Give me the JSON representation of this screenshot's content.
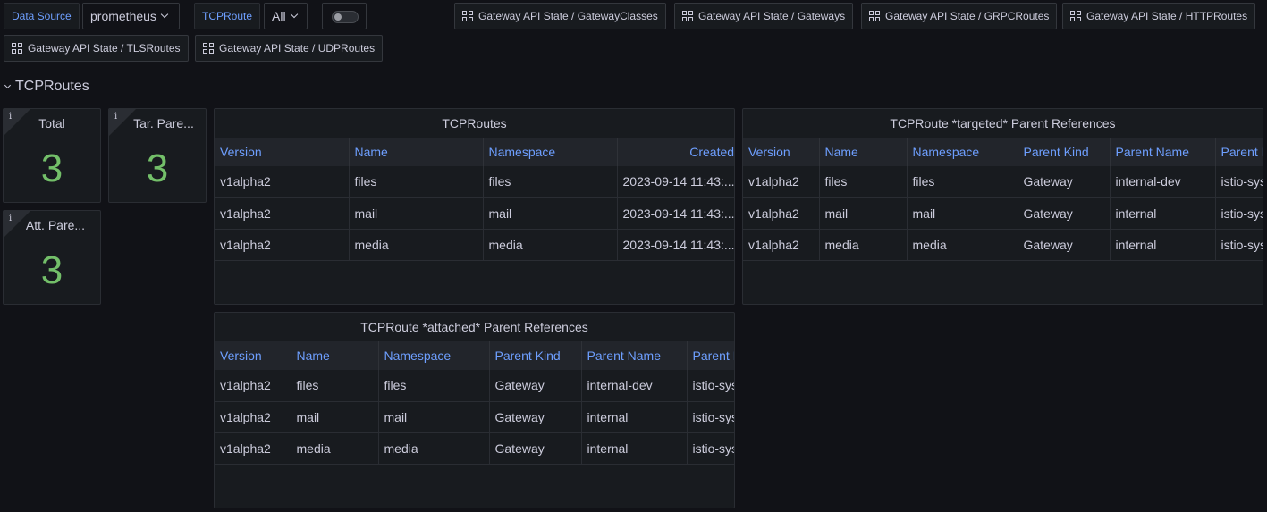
{
  "variables": {
    "datasource_label": "Data Source",
    "datasource_value": "prometheus",
    "tcproute_label": "TCPRoute",
    "tcproute_value": "All"
  },
  "links": [
    "Gateway API State / GatewayClasses",
    "Gateway API State / Gateways",
    "Gateway API State / GRPCRoutes",
    "Gateway API State / HTTPRoutes",
    "Gateway API State / TLSRoutes",
    "Gateway API State / UDPRoutes"
  ],
  "row_title": "TCPRoutes",
  "stats": [
    {
      "title": "Total",
      "value": "3"
    },
    {
      "title": "Tar. Pare...",
      "value": "3"
    },
    {
      "title": "Att. Pare...",
      "value": "3"
    }
  ],
  "tcproutes_table": {
    "title": "TCPRoutes",
    "headers": [
      "Version",
      "Name",
      "Namespace",
      "Created A"
    ],
    "rows": [
      [
        "v1alpha2",
        "files",
        "files",
        "2023-09-14 11:43:..."
      ],
      [
        "v1alpha2",
        "mail",
        "mail",
        "2023-09-14 11:43:..."
      ],
      [
        "v1alpha2",
        "media",
        "media",
        "2023-09-14 11:43:..."
      ]
    ]
  },
  "targeted_table": {
    "title": "TCPRoute *targeted* Parent References",
    "headers": [
      "Version",
      "Name",
      "Namespace",
      "Parent Kind",
      "Parent Name",
      "Parent I"
    ],
    "rows": [
      [
        "v1alpha2",
        "files",
        "files",
        "Gateway",
        "internal-dev",
        "istio-sys"
      ],
      [
        "v1alpha2",
        "mail",
        "mail",
        "Gateway",
        "internal",
        "istio-sys"
      ],
      [
        "v1alpha2",
        "media",
        "media",
        "Gateway",
        "internal",
        "istio-sys"
      ]
    ]
  },
  "attached_table": {
    "title": "TCPRoute *attached* Parent References",
    "headers": [
      "Version",
      "Name",
      "Namespace",
      "Parent Kind",
      "Parent Name",
      "Parent I"
    ],
    "rows": [
      [
        "v1alpha2",
        "files",
        "files",
        "Gateway",
        "internal-dev",
        "istio-sys"
      ],
      [
        "v1alpha2",
        "mail",
        "mail",
        "Gateway",
        "internal",
        "istio-sys"
      ],
      [
        "v1alpha2",
        "media",
        "media",
        "Gateway",
        "internal",
        "istio-sys"
      ]
    ]
  },
  "colors": {
    "background": "#111217",
    "panel": "#181b1f",
    "header_text": "#6e9fff",
    "stat_value": "#73bf69"
  }
}
